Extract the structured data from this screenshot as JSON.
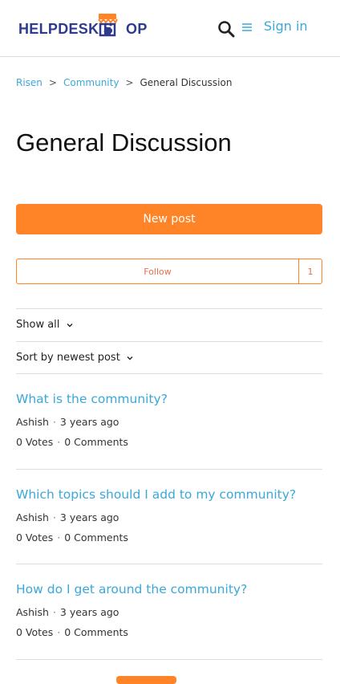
{
  "header": {
    "logo_text_left": "HELPDESK S",
    "logo_text_right": "OP",
    "signin_label": "Sign in"
  },
  "breadcrumb": {
    "items": [
      "Risen",
      "Community",
      "General Discussion"
    ],
    "separator": ">"
  },
  "page": {
    "title": "General Discussion",
    "new_post_label": "New post",
    "follow_label": "Follow",
    "follow_count": "1"
  },
  "filters": {
    "show_label": "Show all",
    "sort_label": "Sort by newest post"
  },
  "posts": [
    {
      "title": "What is the community?",
      "author": "Ashish",
      "time": "3 years ago",
      "votes": "0 Votes",
      "comments": "0 Comments"
    },
    {
      "title": "Which topics should I add to my community?",
      "author": "Ashish",
      "time": "3 years ago",
      "votes": "0 Votes",
      "comments": "0 Comments"
    },
    {
      "title": "How do I get around the community?",
      "author": "Ashish",
      "time": "3 years ago",
      "votes": "0 Votes",
      "comments": "0 Comments"
    }
  ],
  "colors": {
    "accent": "#ff8427",
    "link": "#3aa8d8",
    "brand": "#2f3a8f"
  },
  "icons": [
    "shop-logo-icon",
    "search-icon",
    "menu-icon",
    "chevron-down-icon"
  ]
}
